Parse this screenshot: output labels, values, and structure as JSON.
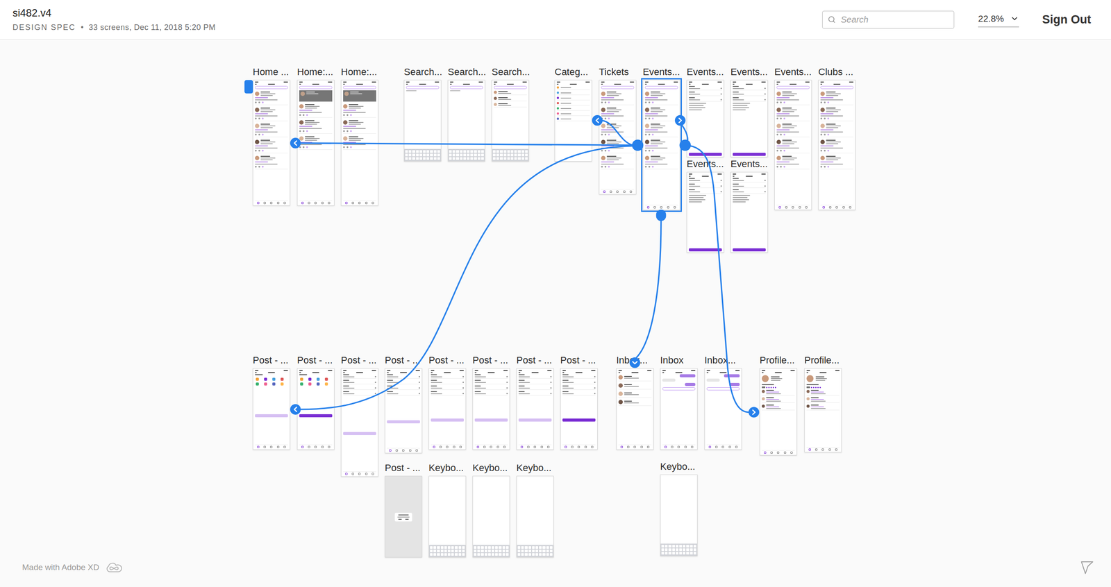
{
  "document": {
    "title": "si482.v4",
    "type": "DESIGN SPEC",
    "separator": "•",
    "meta": "33 screens, Dec 11, 2018 5:20 PM"
  },
  "toolbar": {
    "search_placeholder": "Search",
    "zoom": "22.8%",
    "sign_out": "Sign Out"
  },
  "artboards": [
    {
      "label": "Home ...",
      "kind": "feed",
      "selected": false
    },
    {
      "label": "Home:...",
      "kind": "feed-photo",
      "selected": false
    },
    {
      "label": "Home:...",
      "kind": "feed-photo",
      "selected": false
    },
    {
      "label": "Search...",
      "kind": "search-empty",
      "selected": false
    },
    {
      "label": "Search...",
      "kind": "search-empty",
      "selected": false
    },
    {
      "label": "Search...",
      "kind": "search-results",
      "selected": false
    },
    {
      "label": "Categ...",
      "kind": "categories",
      "selected": false
    },
    {
      "label": "Tickets",
      "kind": "feed",
      "selected": false
    },
    {
      "label": "Events...",
      "kind": "feed",
      "selected": true
    },
    {
      "label": "Events...",
      "kind": "filter",
      "selected": false
    },
    {
      "label": "Events...",
      "kind": "filter",
      "selected": false
    },
    {
      "label": "Events...",
      "kind": "feed",
      "selected": false
    },
    {
      "label": "Clubs ...",
      "kind": "feed",
      "selected": false
    },
    {
      "label": "Events...",
      "kind": "filter",
      "selected": false
    },
    {
      "label": "Events...",
      "kind": "filter",
      "selected": false
    },
    {
      "label": "Post - ...",
      "kind": "post-category",
      "selected": false
    },
    {
      "label": "Post - ...",
      "kind": "post-category-ready",
      "selected": false
    },
    {
      "label": "Post - ...",
      "kind": "post-form",
      "selected": false
    },
    {
      "label": "Post - ...",
      "kind": "post-form",
      "selected": false
    },
    {
      "label": "Post - ...",
      "kind": "post-form",
      "selected": false
    },
    {
      "label": "Post - ...",
      "kind": "post-form",
      "selected": false
    },
    {
      "label": "Post - ...",
      "kind": "post-form",
      "selected": false
    },
    {
      "label": "Post - ...",
      "kind": "post-form-ready",
      "selected": false
    },
    {
      "label": "Inbox...",
      "kind": "inbox",
      "selected": false
    },
    {
      "label": "Inbox",
      "kind": "chat",
      "selected": false
    },
    {
      "label": "Inbox...",
      "kind": "chat",
      "selected": false
    },
    {
      "label": "Profile...",
      "kind": "profile",
      "selected": false
    },
    {
      "label": "Profile...",
      "kind": "profile",
      "selected": false
    },
    {
      "label": "Post - ...",
      "kind": "dialog",
      "selected": false
    },
    {
      "label": "Keybo...",
      "kind": "keyboard",
      "selected": false
    },
    {
      "label": "Keybo...",
      "kind": "keyboard",
      "selected": false
    },
    {
      "label": "Keybo...",
      "kind": "keyboard",
      "selected": false
    },
    {
      "label": "Keybo...",
      "kind": "keyboard",
      "selected": false
    }
  ],
  "footer": {
    "credit": "Made with Adobe XD"
  }
}
